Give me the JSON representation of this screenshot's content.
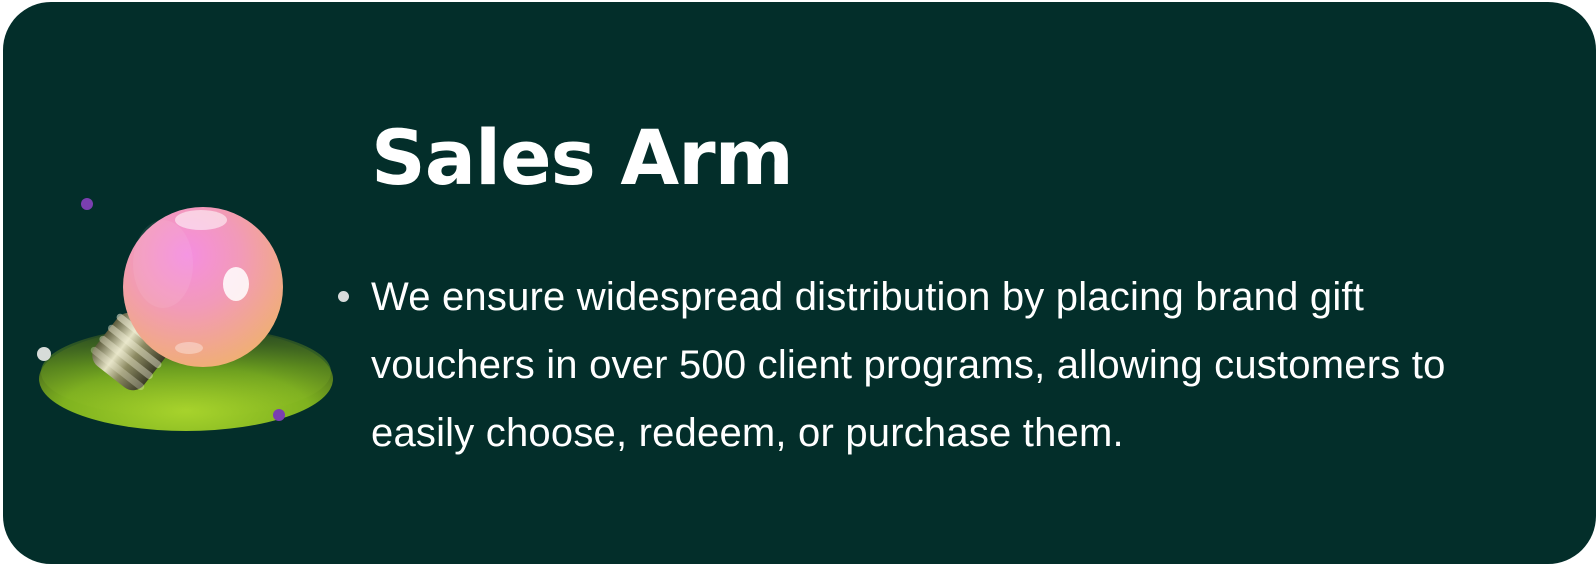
{
  "card": {
    "title": "Sales Arm",
    "bullets": [
      "We ensure widespread distribution by placing brand gift vouchers in over 500 client programs, allowing customers to easily choose, redeem, or purchase them."
    ]
  },
  "illustration": {
    "icon": "lightbulb-icon"
  },
  "colors": {
    "background": "#032e2a",
    "text": "#ffffff",
    "accent_green": "#9fcf2f",
    "bulb_pink": "#f07ad8",
    "bulb_orange": "#f2b070",
    "dot_purple": "#7a3fb0"
  }
}
